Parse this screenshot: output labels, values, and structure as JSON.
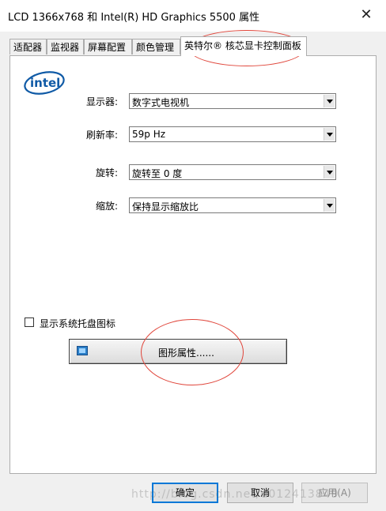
{
  "window": {
    "title": "LCD 1366x768 和 Intel(R) HD Graphics 5500 属性",
    "close_glyph": "✕"
  },
  "tabs": [
    {
      "label": "适配器",
      "active": false
    },
    {
      "label": "监视器",
      "active": false
    },
    {
      "label": "屏幕配置",
      "active": false
    },
    {
      "label": "颜色管理",
      "active": false
    },
    {
      "label": "英特尔® 核芯显卡控制面板",
      "active": true
    }
  ],
  "logo": {
    "text": "intel",
    "color": "#0f5aa6"
  },
  "fields": {
    "display": {
      "label": "显示器:",
      "value": "数字式电视机"
    },
    "refresh": {
      "label": "刷新率:",
      "value": "59p Hz"
    },
    "rotation": {
      "label": "旋转:",
      "value": "旋转至 0 度"
    },
    "scaling": {
      "label": "缩放:",
      "value": "保持显示缩放比"
    }
  },
  "tray_checkbox": {
    "label": "显示系统托盘图标",
    "checked": false
  },
  "graphics_button": {
    "label": "图形属性......"
  },
  "buttons": {
    "ok": "确定",
    "cancel": "取消",
    "apply": "应用(A)"
  },
  "watermark": "http://blog.csdn.net/u012413849",
  "colors": {
    "annotation": "#e0453a",
    "accent": "#0078d7"
  }
}
